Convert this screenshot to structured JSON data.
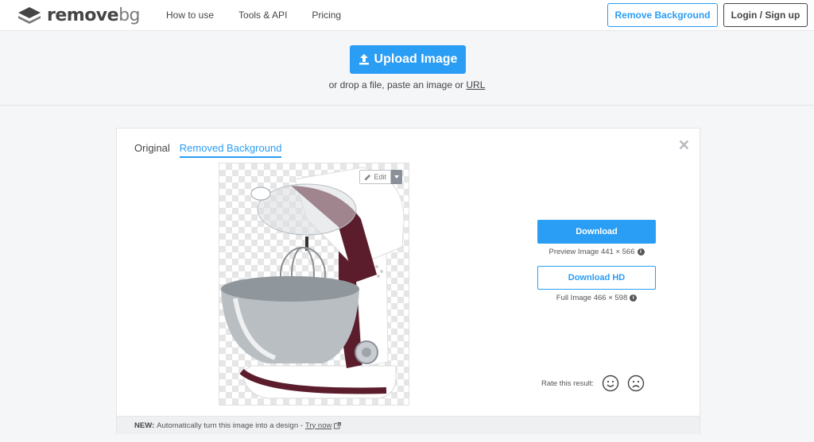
{
  "brand": {
    "name_main": "remove",
    "name_suffix": "bg"
  },
  "nav": {
    "items": [
      {
        "label": "How to use"
      },
      {
        "label": "Tools & API"
      },
      {
        "label": "Pricing"
      }
    ]
  },
  "header": {
    "remove_bg_label": "Remove Background",
    "login_label": "Login / Sign up"
  },
  "upload": {
    "button_label": "Upload Image",
    "hint_prefix": "or drop a file, paste an image or",
    "hint_link": "URL"
  },
  "result": {
    "tabs": [
      {
        "label": "Original",
        "active": false
      },
      {
        "label": "Removed Background",
        "active": true
      }
    ],
    "close_label": "✕",
    "edit_label": "Edit",
    "download_label": "Download",
    "preview_info": "Preview Image 441 × 566",
    "download_hd_label": "Download HD",
    "full_info": "Full Image 466 × 598",
    "rate_label": "Rate this result:",
    "footer_new": "NEW:",
    "footer_text": "Automatically turn this image into a design -",
    "footer_link": "Try now"
  },
  "colors": {
    "accent": "#2a9df4",
    "text": "#454545",
    "background": "#f5f6f8"
  },
  "icons": [
    "logo-icon",
    "upload-icon",
    "close-icon",
    "pencil-icon",
    "caret-down-icon",
    "info-icon",
    "smile-icon",
    "frown-icon",
    "external-link-icon"
  ]
}
